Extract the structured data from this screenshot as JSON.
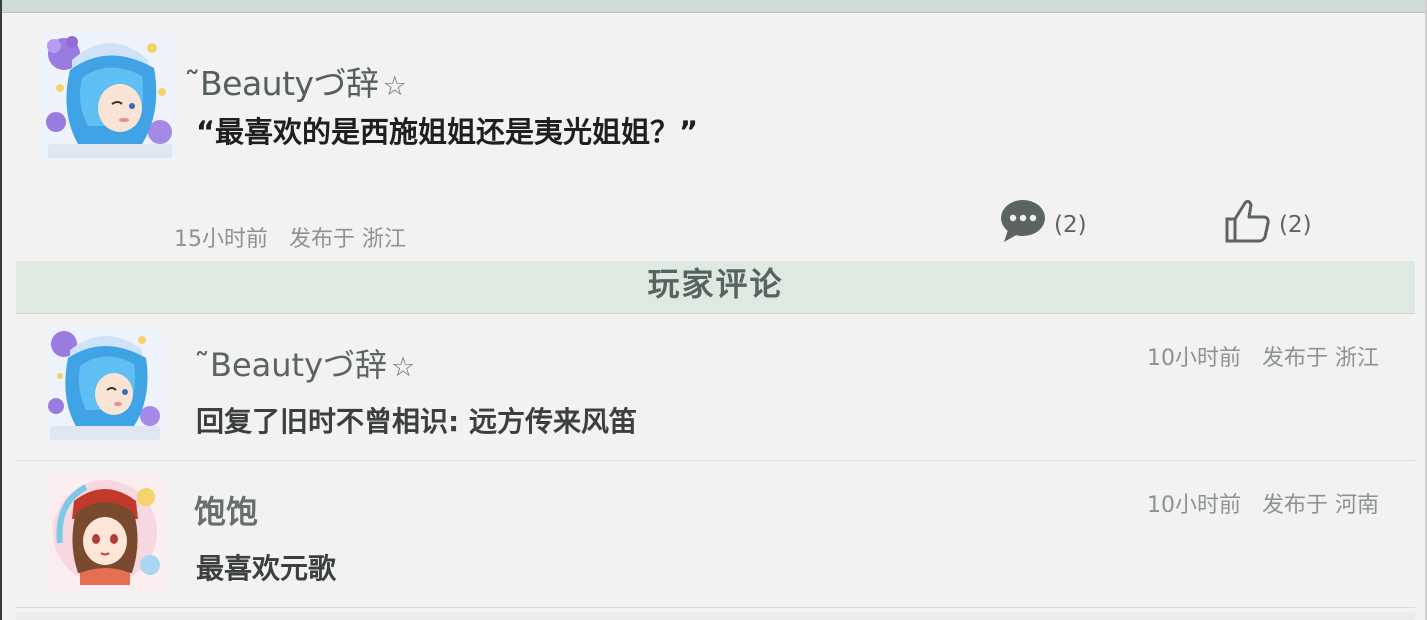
{
  "post": {
    "author": "˜Beautyづ辞",
    "author_badge": "☆",
    "content": "“最喜欢的是西施姐姐还是夷光姐姐？”",
    "time": "15小时前",
    "location": "发布于 浙江",
    "comment_count": "(2)",
    "like_count": "(2)",
    "avatar_icon": "mermaid-avatar"
  },
  "comments_section": {
    "title": "玩家评论"
  },
  "comments": [
    {
      "author": "˜Beautyづ辞",
      "author_badge": "☆",
      "time": "10小时前",
      "location": "发布于 浙江",
      "text": "回复了旧时不曾相识: 远方传来风笛",
      "avatar_icon": "mermaid-avatar"
    },
    {
      "author": "饱饱",
      "time": "10小时前",
      "location": "发布于 河南",
      "text": "最喜欢元歌",
      "avatar_icon": "girl-avatar"
    }
  ],
  "colors": {
    "header_bg": "#dfe9e2",
    "accent_text": "#566461",
    "page_bg": "#f2f2f2"
  }
}
